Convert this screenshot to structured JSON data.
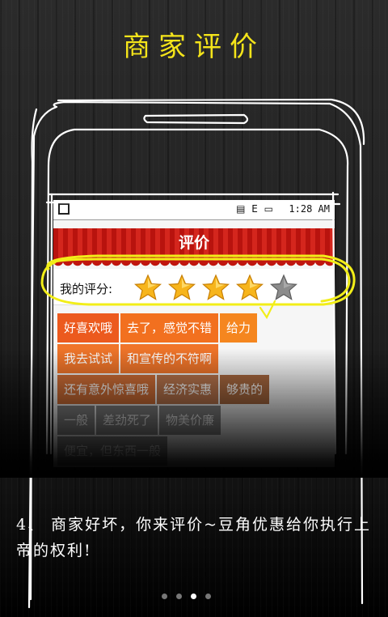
{
  "page_title": "商家评价",
  "status_bar": {
    "time": "1:28 AM",
    "icons": "▤ E ▭"
  },
  "app_header": {
    "title": "评价"
  },
  "rating": {
    "label": "我的评分:",
    "stars_filled": 4,
    "stars_total": 5
  },
  "annotation_text": "给力",
  "tags": [
    [
      {
        "label": "好喜欢哦",
        "color": "#ec5a1e"
      },
      {
        "label": "去了，感觉不错",
        "color": "#f2701f"
      },
      {
        "label": "给力",
        "color": "#f5861f"
      }
    ],
    [
      {
        "label": "我去试试",
        "color": "#f0752a"
      },
      {
        "label": "和宣传的不符啊",
        "color": "#f0752a"
      }
    ],
    [
      {
        "label": "还有意外惊喜哦",
        "color": "#d06e36"
      },
      {
        "label": "经济实惠",
        "color": "#b8744c"
      },
      {
        "label": "够贵的",
        "color": "#a8683f"
      }
    ],
    [
      {
        "label": "一般",
        "color": "#8a8a8a"
      },
      {
        "label": "差劲死了",
        "color": "#8a8a8a"
      },
      {
        "label": "物美价廉",
        "color": "#8a8a8a"
      }
    ],
    [
      {
        "label": "便宜，但东西一般",
        "color": "#8a8a8a"
      }
    ]
  ],
  "description": "4、 商家好坏，你来评价~豆角优惠给你执行上帝的权利!",
  "pager": {
    "count": 4,
    "active": 2
  },
  "colors": {
    "title_yellow": "#f4e41a",
    "header_red": "#c0160f",
    "highlight_yellow": "#f2ee18"
  }
}
